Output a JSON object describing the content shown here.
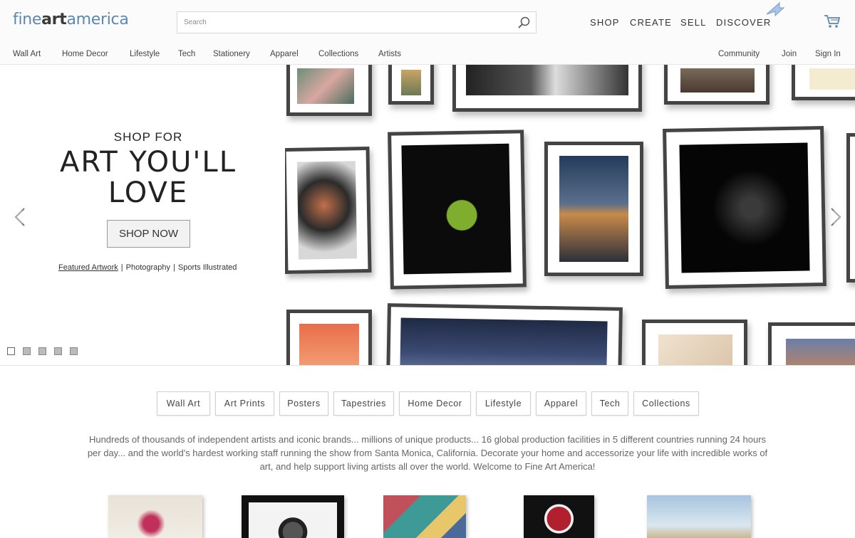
{
  "header": {
    "logo": {
      "part1": "fine",
      "part2": "art",
      "part3": "america"
    },
    "search_placeholder": "Search",
    "topnav": [
      "SHOP",
      "CREATE",
      "SELL",
      "DISCOVER"
    ],
    "subnav_left": [
      "Wall Art",
      "Home Decor",
      "Lifestyle",
      "Tech",
      "Stationery",
      "Apparel",
      "Collections",
      "Artists"
    ],
    "subnav_right": [
      "Community",
      "Join",
      "Sign In"
    ]
  },
  "hero": {
    "shop_for": "SHOP FOR",
    "headline_line1": "ART YOU'LL",
    "headline_line2": "LOVE",
    "cta": "SHOP NOW",
    "links": [
      "Featured Artwork",
      "Photography",
      "Sports Illustrated"
    ],
    "slide_count": 5,
    "active_slide": 1
  },
  "categories": [
    "Wall Art",
    "Art Prints",
    "Posters",
    "Tapestries",
    "Home Decor",
    "Lifestyle",
    "Apparel",
    "Tech",
    "Collections"
  ],
  "blurb": "Hundreds of thousands of independent artists and iconic brands... millions of unique products... 16 global production facilities in 5 different countries running 24 hours per day... and the world's hardest working staff running the show from Santa Monica, California.   Decorate your home and accessorize your life with incredible works of art, and help support living artists all over the world.   Welcome to Fine Art America!",
  "colors": {
    "logo_accent": "#5b88b0",
    "frame": "#444444"
  }
}
